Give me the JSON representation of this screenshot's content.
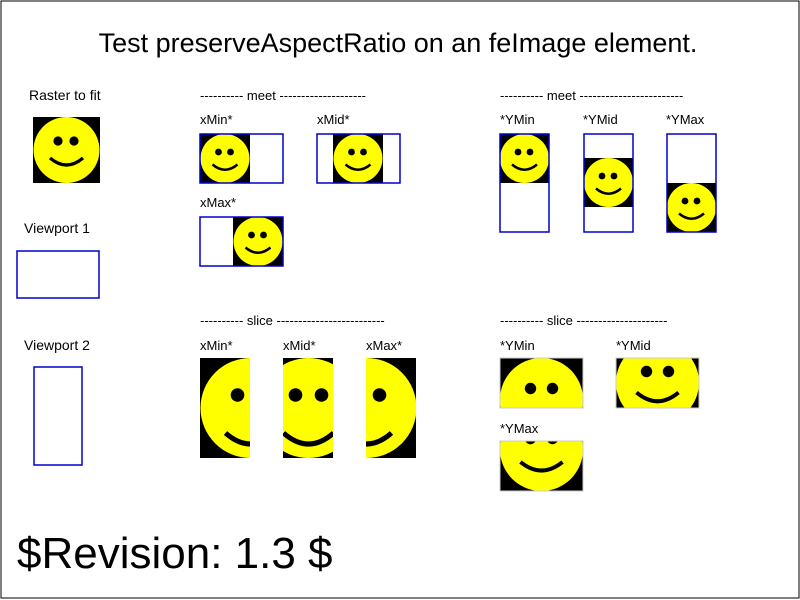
{
  "title": "Test preserveAspectRatio on an feImage element.",
  "revision": "$Revision: 1.3 $",
  "labels": {
    "raster": "Raster to fit",
    "viewport1": "Viewport 1",
    "viewport2": "Viewport 2",
    "meet_x_header": "---------- meet --------------------",
    "meet_y_header": "---------- meet ------------------------",
    "slice_x_header": "---------- slice -------------------------",
    "slice_y_header": "---------- slice ---------------------",
    "xmin": "xMin*",
    "xmid": "xMid*",
    "xmax": "xMax*",
    "ymin": "*YMin",
    "ymid": "*YMid",
    "ymax": "*YMax"
  },
  "colors": {
    "face": "#ffff00",
    "raster_bg": "#000000",
    "viewport_border": "#0000cc",
    "frame_border": "#000000"
  }
}
